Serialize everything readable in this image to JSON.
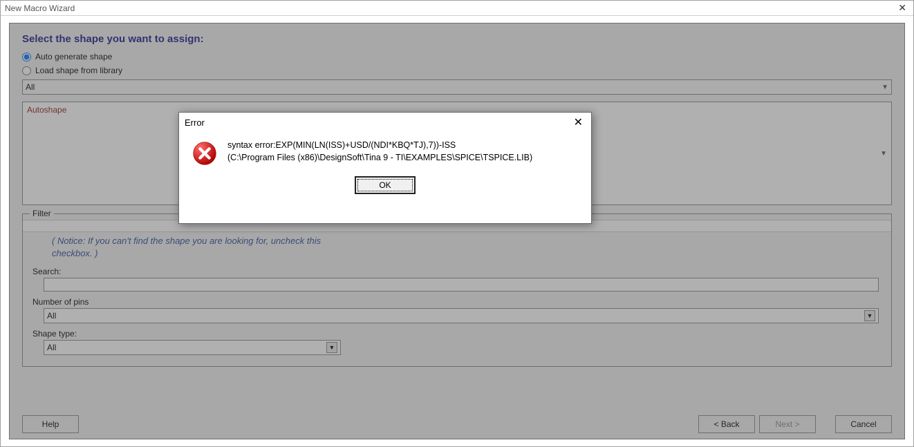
{
  "wizard": {
    "title": "New Macro Wizard",
    "section_title": "Select the shape you want to assign:",
    "radios": {
      "auto": "Auto generate shape",
      "load": "Load shape from library"
    },
    "lib_combo": "All",
    "shape_list_item": "Autoshape",
    "filter": {
      "legend": "Filter",
      "notice": "( Notice: If you can't find the shape you are looking for, uncheck this checkbox. )",
      "search_label": "Search:",
      "search_value": "",
      "pins_label": "Number of pins",
      "pins_value": "All",
      "type_label": "Shape type:",
      "type_value": "All"
    },
    "buttons": {
      "help": "Help",
      "back": "< Back",
      "next": "Next >",
      "cancel": "Cancel"
    }
  },
  "error": {
    "title": "Error",
    "line1": "syntax error:EXP(MIN(LN(ISS)+USD/(NDI*KBQ*TJ),7))-ISS",
    "line2": "(C:\\Program Files (x86)\\DesignSoft\\Tina 9 - TI\\EXAMPLES\\SPICE\\TSPICE.LIB)",
    "ok": "OK"
  }
}
